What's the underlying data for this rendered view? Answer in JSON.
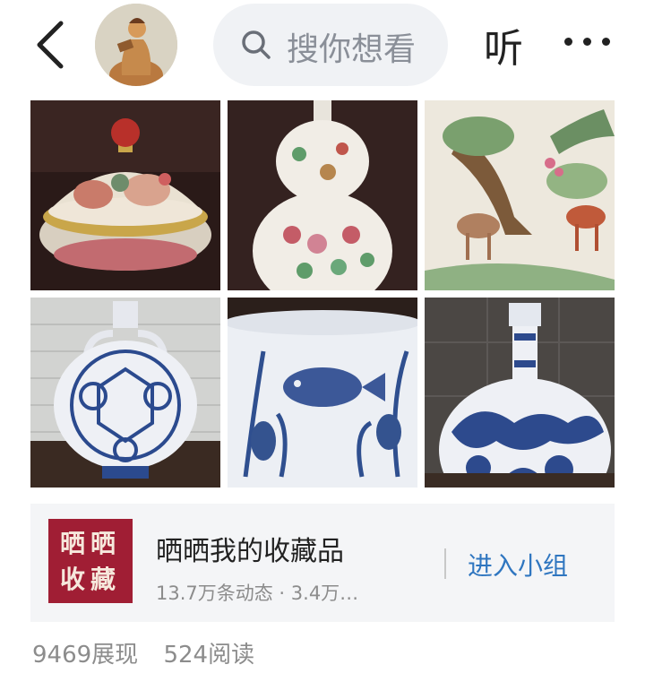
{
  "header": {
    "search_placeholder": "搜你想看",
    "listen_label": "听"
  },
  "gallery": {
    "images": [
      {
        "icon": "famille-rose-covered-bowl"
      },
      {
        "icon": "famille-rose-double-gourd-vase"
      },
      {
        "icon": "famille-rose-horse-vase"
      },
      {
        "icon": "blue-white-moon-flask"
      },
      {
        "icon": "blue-white-fish-bowl"
      },
      {
        "icon": "blue-white-dragon-flask"
      }
    ]
  },
  "group": {
    "icon_text_line1": "晒晒",
    "icon_text_line2": "收藏",
    "name": "晒晒我的收藏品",
    "stats": "13.7万条动态 · 3.4万…",
    "enter_label": "进入小组",
    "icon_color": "#a01e34"
  },
  "footer": {
    "views": "9469展现",
    "reads": "524阅读"
  }
}
